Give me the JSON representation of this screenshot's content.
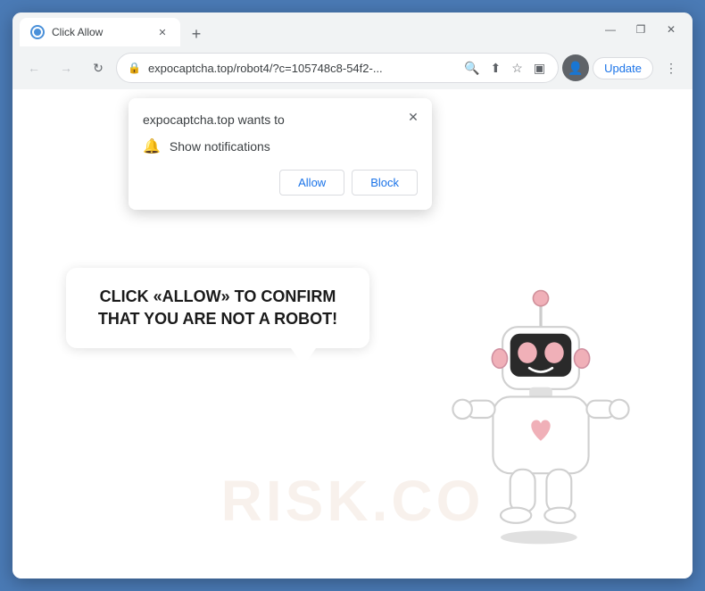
{
  "browser": {
    "tab": {
      "favicon_label": "site-favicon",
      "title": "Click Allow",
      "close_label": "✕"
    },
    "new_tab_label": "+",
    "window_controls": {
      "minimize": "—",
      "maximize": "❐",
      "close": "✕"
    },
    "nav": {
      "back": "←",
      "forward": "→",
      "reload": "↻"
    },
    "address": {
      "lock_icon": "🔒",
      "url": "expocaptcha.top/robot4/?c=105748c8-54f2-..."
    },
    "toolbar_icons": {
      "search": "🔍",
      "share": "⬆",
      "bookmark": "☆",
      "split": "▣"
    },
    "update_button": "Update",
    "more_icon": "⋮"
  },
  "notification_popup": {
    "title": "expocaptcha.top wants to",
    "close_icon": "✕",
    "permission": "Show notifications",
    "allow_button": "Allow",
    "block_button": "Block"
  },
  "page_content": {
    "speech_bubble": "CLICK «ALLOW» TO CONFIRM THAT YOU ARE NOT A ROBOT!",
    "watermark": "RISK.CO"
  }
}
